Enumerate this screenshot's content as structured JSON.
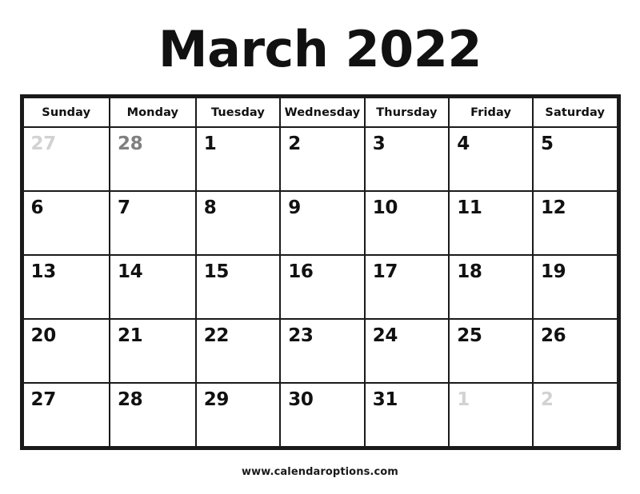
{
  "header": {
    "title": "March 2022"
  },
  "calendar": {
    "month": "March",
    "year": "2022",
    "weekday_headers": [
      {
        "label": "Sunday",
        "weekend": true
      },
      {
        "label": "Monday",
        "weekend": false
      },
      {
        "label": "Tuesday",
        "weekend": false
      },
      {
        "label": "Wednesday",
        "weekend": false
      },
      {
        "label": "Thursday",
        "weekend": false
      },
      {
        "label": "Friday",
        "weekend": false
      },
      {
        "label": "Saturday",
        "weekend": true
      }
    ],
    "weeks": [
      [
        {
          "day": "27",
          "state": "prev-faint"
        },
        {
          "day": "28",
          "state": "prev"
        },
        {
          "day": "1",
          "state": "current"
        },
        {
          "day": "2",
          "state": "current"
        },
        {
          "day": "3",
          "state": "current"
        },
        {
          "day": "4",
          "state": "current"
        },
        {
          "day": "5",
          "state": "current"
        }
      ],
      [
        {
          "day": "6",
          "state": "current"
        },
        {
          "day": "7",
          "state": "current"
        },
        {
          "day": "8",
          "state": "current"
        },
        {
          "day": "9",
          "state": "current"
        },
        {
          "day": "10",
          "state": "current"
        },
        {
          "day": "11",
          "state": "current"
        },
        {
          "day": "12",
          "state": "current"
        }
      ],
      [
        {
          "day": "13",
          "state": "current"
        },
        {
          "day": "14",
          "state": "current"
        },
        {
          "day": "15",
          "state": "current"
        },
        {
          "day": "16",
          "state": "current"
        },
        {
          "day": "17",
          "state": "current"
        },
        {
          "day": "18",
          "state": "current"
        },
        {
          "day": "19",
          "state": "current"
        }
      ],
      [
        {
          "day": "20",
          "state": "current"
        },
        {
          "day": "21",
          "state": "current"
        },
        {
          "day": "22",
          "state": "current"
        },
        {
          "day": "23",
          "state": "current"
        },
        {
          "day": "24",
          "state": "current"
        },
        {
          "day": "25",
          "state": "current"
        },
        {
          "day": "26",
          "state": "current"
        }
      ],
      [
        {
          "day": "27",
          "state": "current"
        },
        {
          "day": "28",
          "state": "current"
        },
        {
          "day": "29",
          "state": "current"
        },
        {
          "day": "30",
          "state": "current"
        },
        {
          "day": "31",
          "state": "current"
        },
        {
          "day": "1",
          "state": "next-faint"
        },
        {
          "day": "2",
          "state": "next-faint"
        }
      ]
    ]
  },
  "footer": {
    "website": "www.calendaroptions.com"
  },
  "colors": {
    "text": "#111111",
    "grid_line": "#1a1a1a",
    "weekend_background": "#f7f7f7",
    "adjacent_month_dark": "#808080",
    "adjacent_month_light": "#d2d2d2",
    "page_background": "#ffffff"
  }
}
